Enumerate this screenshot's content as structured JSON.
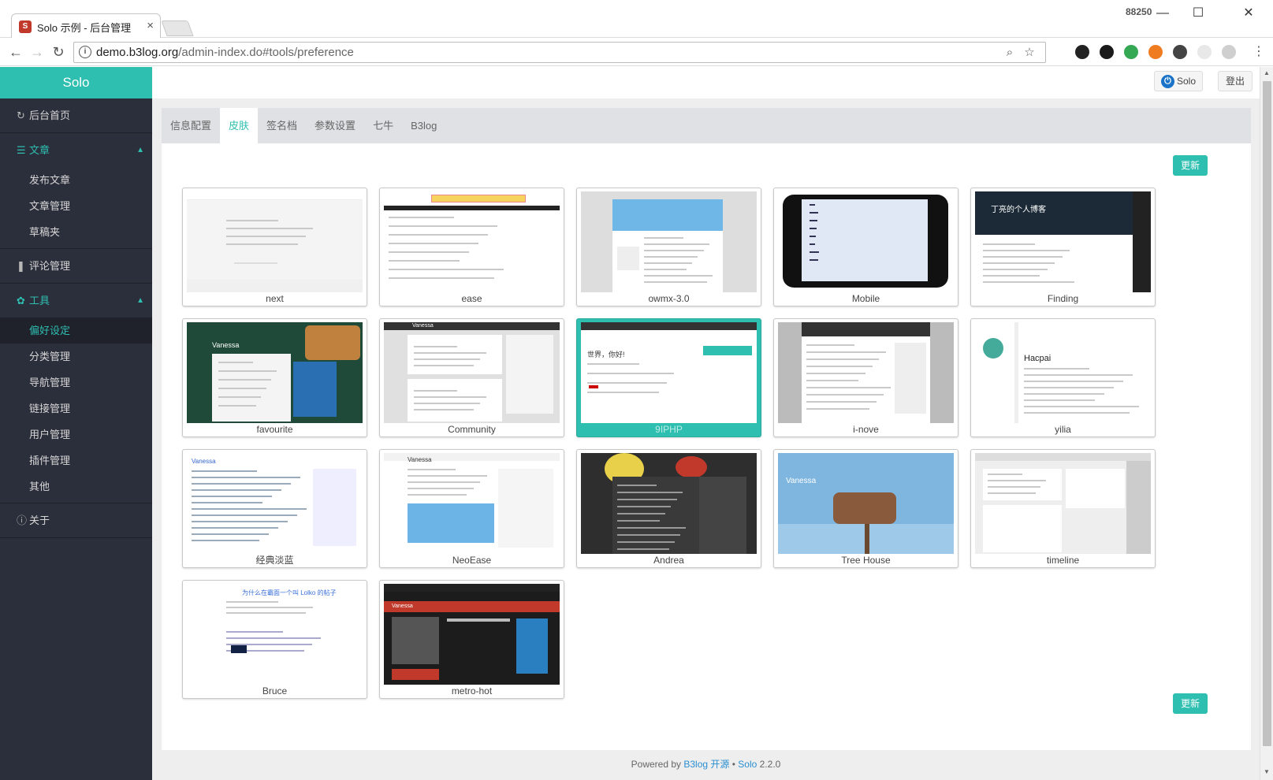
{
  "browser": {
    "tab_title": "Solo 示例 - 后台管理",
    "tab_close": "×",
    "favicon": "S",
    "user_label": "88250",
    "url_host": "demo.b3log.org",
    "url_path": "/admin-index.do#tools/preference",
    "controls": {
      "minimize": "—",
      "maximize": "☐",
      "close": "✕"
    },
    "nav": {
      "back": "←",
      "forward": "→",
      "reload": "↻"
    },
    "omni": {
      "info": "i",
      "zoom": "⌕",
      "star": "☆"
    },
    "extensions": [
      "#222",
      "#1a1a1a",
      "#34a853",
      "#f07c22",
      "#444",
      "#e8e8e8",
      "#cfcfcf"
    ]
  },
  "sidebar": {
    "brand": "Solo",
    "groups": [
      {
        "icon": "↻",
        "label": "后台首页",
        "active": false,
        "items": []
      },
      {
        "icon": "☰",
        "label": "文章",
        "active": true,
        "caret": "▲",
        "items": [
          {
            "label": "发布文章"
          },
          {
            "label": "文章管理"
          },
          {
            "label": "草稿夹"
          }
        ]
      },
      {
        "icon": "❚",
        "label": "评论管理",
        "active": false,
        "items": []
      },
      {
        "icon": "✿",
        "label": "工具",
        "active": true,
        "caret": "▲",
        "items": [
          {
            "label": "偏好设定",
            "current": true
          },
          {
            "label": "分类管理"
          },
          {
            "label": "导航管理"
          },
          {
            "label": "链接管理"
          },
          {
            "label": "用户管理"
          },
          {
            "label": "插件管理"
          },
          {
            "label": "其他"
          }
        ]
      },
      {
        "icon": "ⓘ",
        "label": "关于",
        "active": false,
        "items": []
      }
    ]
  },
  "topbar": {
    "user": "Solo",
    "power_icon": "⏻",
    "logout": "登出"
  },
  "tabs": [
    {
      "label": "信息配置",
      "active": false
    },
    {
      "label": "皮肤",
      "active": true
    },
    {
      "label": "签名档",
      "active": false
    },
    {
      "label": "参数设置",
      "active": false
    },
    {
      "label": "七牛",
      "active": false
    },
    {
      "label": "B3log",
      "active": false
    }
  ],
  "buttons": {
    "update_top": "更新",
    "update_bottom": "更新"
  },
  "skins": [
    {
      "name": "next",
      "style": "light",
      "selected": false
    },
    {
      "name": "ease",
      "style": "ease",
      "selected": false
    },
    {
      "name": "owmx-3.0",
      "style": "sky",
      "selected": false
    },
    {
      "name": "Mobile",
      "style": "phone",
      "selected": false
    },
    {
      "name": "Finding",
      "style": "dark",
      "selected": false,
      "caption": "丁亮的个人博客"
    },
    {
      "name": "favourite",
      "style": "green",
      "selected": false,
      "caption": "Vanessa"
    },
    {
      "name": "Community",
      "style": "gray",
      "selected": false,
      "caption": "Vanessa"
    },
    {
      "name": "9IPHP",
      "style": "teal",
      "selected": true,
      "caption": "世界，你好!"
    },
    {
      "name": "i-nove",
      "style": "silver",
      "selected": false
    },
    {
      "name": "yilia",
      "style": "yilia",
      "selected": false,
      "caption": "Hacpai"
    },
    {
      "name": "经典淡蓝",
      "style": "blue",
      "selected": false,
      "caption": "Vanessa"
    },
    {
      "name": "NeoEase",
      "style": "neo",
      "selected": false,
      "caption": "Vanessa"
    },
    {
      "name": "Andrea",
      "style": "andrea",
      "selected": false
    },
    {
      "name": "Tree House",
      "style": "tree",
      "selected": false,
      "caption": "Vanessa"
    },
    {
      "name": "timeline",
      "style": "timeline",
      "selected": false
    },
    {
      "name": "Bruce",
      "style": "bruce",
      "selected": false,
      "caption": "为什么在霸面一个叫 Lolko 的帖子"
    },
    {
      "name": "metro-hot",
      "style": "metro",
      "selected": false,
      "caption": "Vanessa"
    }
  ],
  "footer": {
    "prefix": "Powered by ",
    "b3log": "B3log 开源",
    "sep": " • ",
    "solo": "Solo",
    "version": " 2.2.0"
  },
  "colors": {
    "accent": "#2ebfb0",
    "sidebar": "#2b2e3b",
    "link": "#2a8fd1"
  }
}
